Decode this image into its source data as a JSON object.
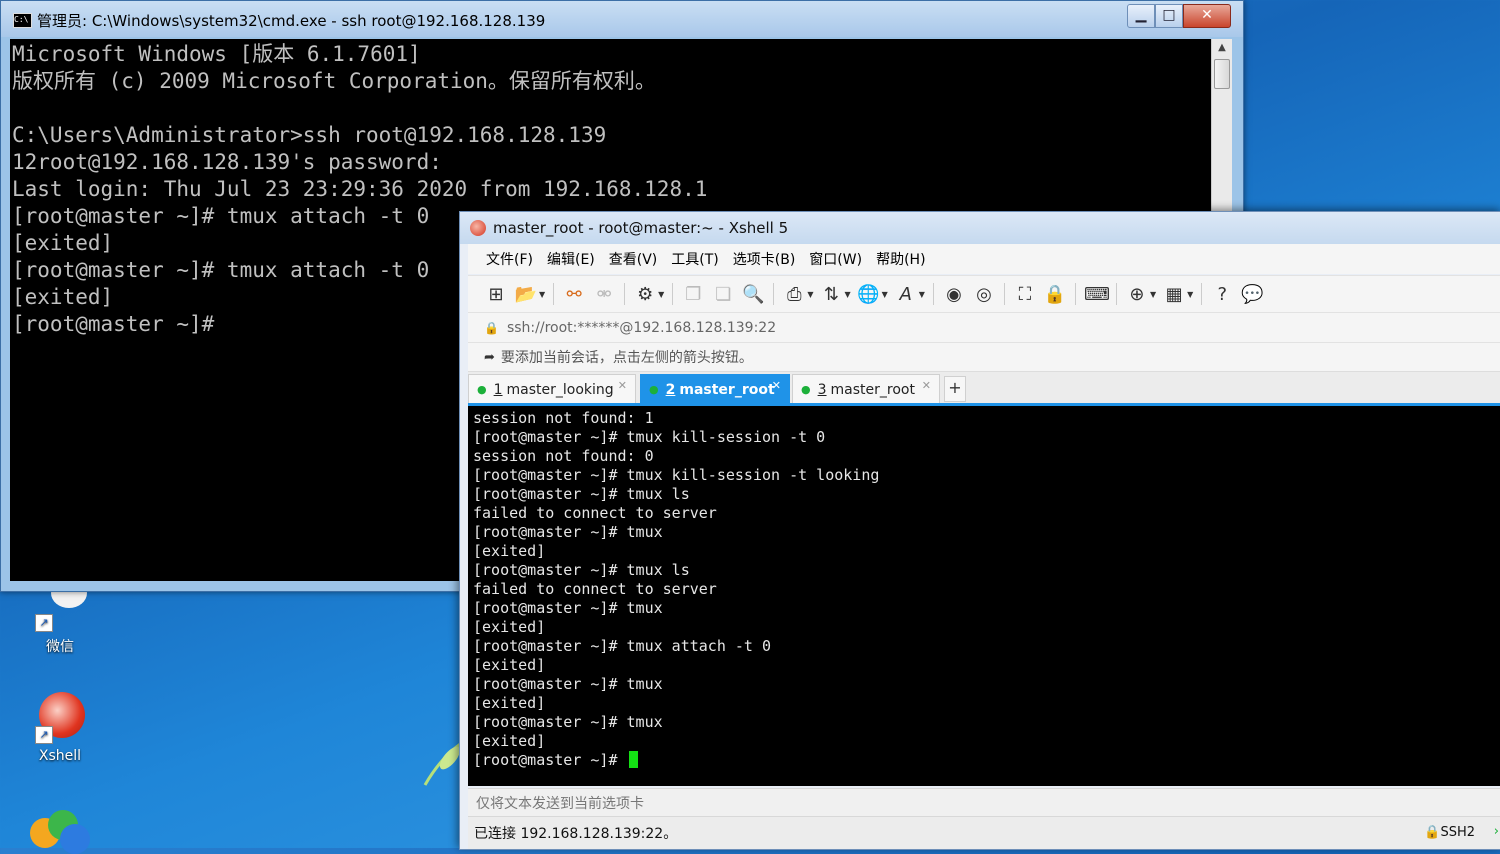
{
  "desktop": {
    "icons": [
      {
        "label": "微信",
        "icon": "wechat-icon"
      },
      {
        "label": "Xshell",
        "icon": "xshell-icon"
      }
    ]
  },
  "cmd": {
    "title": "管理员: C:\\Windows\\system32\\cmd.exe - ssh  root@192.168.128.139",
    "icon": "cmd-icon",
    "lines": [
      "Microsoft Windows [版本 6.1.7601]",
      "版权所有 (c) 2009 Microsoft Corporation。保留所有权利。",
      "",
      "C:\\Users\\Administrator>ssh root@192.168.128.139",
      "12root@192.168.128.139's password:",
      "Last login: Thu Jul 23 23:29:36 2020 from 192.168.128.1",
      "[root@master ~]# tmux attach -t 0",
      "[exited]",
      "[root@master ~]# tmux attach -t 0",
      "[exited]",
      "[root@master ~]#"
    ]
  },
  "xshell": {
    "title": "master_root - root@master:~ - Xshell 5",
    "menu": [
      "文件(F)",
      "编辑(E)",
      "查看(V)",
      "工具(T)",
      "选项卡(B)",
      "窗口(W)",
      "帮助(H)"
    ],
    "toolbar_icons": [
      "new-session-icon",
      "open-folder-icon",
      "reconnect-icon",
      "disconnect-icon",
      "properties-icon",
      "copy-icon",
      "paste-icon",
      "find-icon",
      "print-icon",
      "transfer-icon",
      "globe-icon",
      "font-icon",
      "xftp-icon",
      "xagent-icon",
      "fullscreen-icon",
      "lock-icon",
      "keyboard-icon",
      "new-tab-icon",
      "layout-icon",
      "help-icon",
      "chat-icon"
    ],
    "address": "ssh://root:******@192.168.128.139:22",
    "hint": "要添加当前会话，点击左侧的箭头按钮。",
    "tabs": [
      {
        "num": "1",
        "label": "master_looking",
        "active": false
      },
      {
        "num": "2",
        "label": "master_root",
        "active": true
      },
      {
        "num": "3",
        "label": "master_root",
        "active": false
      }
    ],
    "terminal_lines": [
      "session not found: 1",
      "[root@master ~]# tmux kill-session -t 0",
      "session not found: 0",
      "[root@master ~]# tmux kill-session -t looking",
      "[root@master ~]# tmux ls",
      "failed to connect to server",
      "[root@master ~]# tmux",
      "[exited]",
      "[root@master ~]# tmux ls",
      "failed to connect to server",
      "[root@master ~]# tmux",
      "[exited]",
      "[root@master ~]# tmux attach -t 0",
      "[exited]",
      "[root@master ~]# tmux",
      "[exited]",
      "[root@master ~]# tmux",
      "[exited]"
    ],
    "prompt": "[root@master ~]#",
    "send_placeholder": "仅将文本发送到当前选项卡",
    "status_left": "已连接 192.168.128.139:22。",
    "status_right": "SSH2",
    "colors": {
      "accent": "#1f93e8",
      "cursor": "#14e014",
      "tab_dot": "#1cb03a"
    }
  }
}
